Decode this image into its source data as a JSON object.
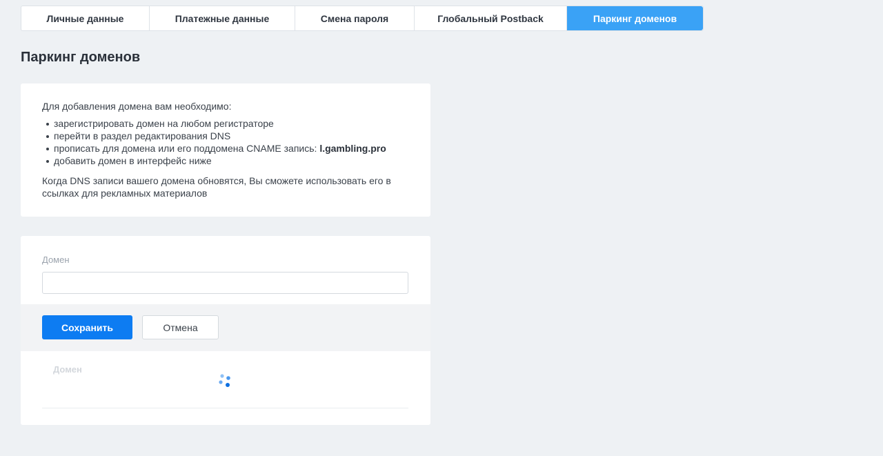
{
  "tabs": [
    {
      "label": "Личные данные",
      "active": false
    },
    {
      "label": "Платежные данные",
      "active": false
    },
    {
      "label": "Смена пароля",
      "active": false
    },
    {
      "label": "Глобальный Postback",
      "active": false
    },
    {
      "label": "Паркинг доменов",
      "active": true
    }
  ],
  "page_title": "Паркинг доменов",
  "info": {
    "intro": "Для добавления домена вам необходимо:",
    "steps": [
      "зарегистрировать домен на любом регистраторе",
      "перейти в раздел редактирования DNS",
      "прописать для домена или его поддомена CNAME запись: ",
      "добавить домен в интерфейс ниже"
    ],
    "cname_value": "l.gambling.pro",
    "note": "Когда DNS записи вашего домена обновятся, Вы сможете использовать его в ссылках для рекламных материалов"
  },
  "form": {
    "domain_label": "Домен",
    "domain_value": "",
    "save_label": "Сохранить",
    "cancel_label": "Отмена"
  },
  "table": {
    "column_domain": "Домен",
    "loading": true
  },
  "colors": {
    "accent": "#3aa2f6",
    "primary_button": "#0d7cf2",
    "background": "#eef1f4"
  },
  "icons": {
    "loading": "loading-spinner-icon"
  }
}
